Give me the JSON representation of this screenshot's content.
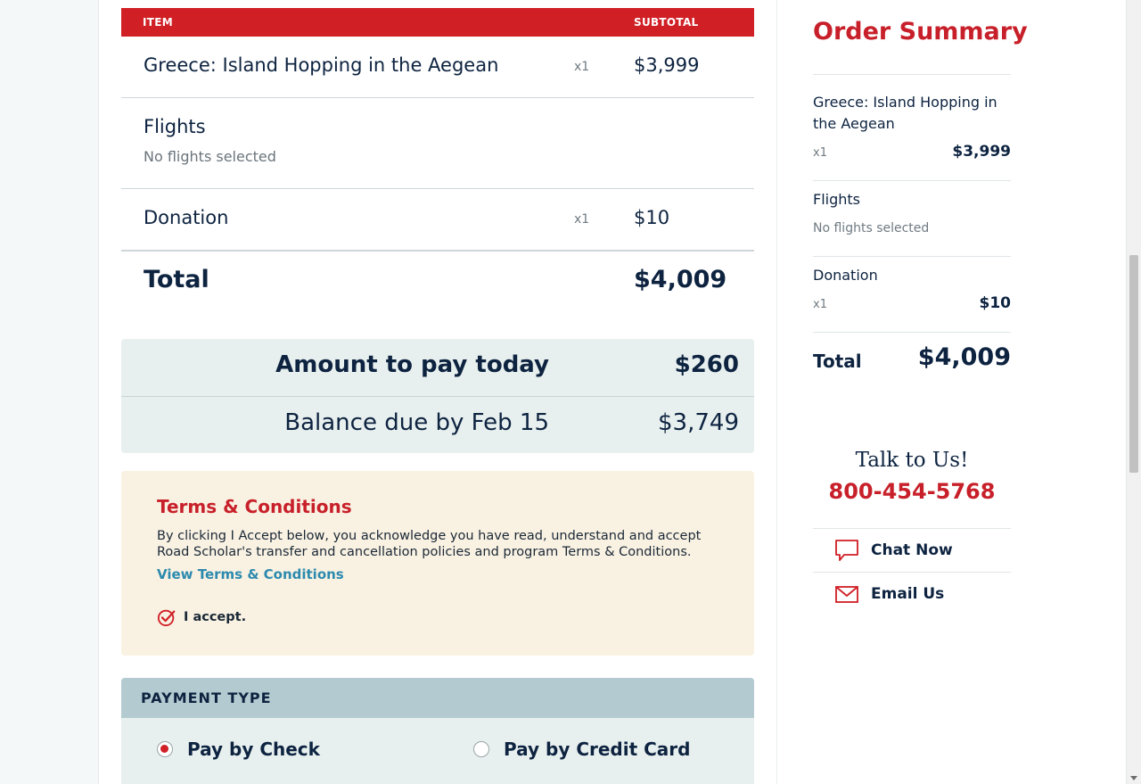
{
  "cart": {
    "header_item": "ITEM",
    "header_subtotal": "SUBTOTAL",
    "trip": {
      "name": "Greece: Island Hopping in the Aegean",
      "qty": "x1",
      "price": "$3,999"
    },
    "flights": {
      "name": "Flights",
      "note": "No flights selected"
    },
    "donation": {
      "name": "Donation",
      "qty": "x1",
      "price": "$10"
    },
    "total_label": "Total",
    "total_value": "$4,009"
  },
  "payment_summary": {
    "today_label": "Amount to pay today",
    "today_value": "$260",
    "balance_label": "Balance due by Feb 15",
    "balance_value": "$3,749"
  },
  "terms": {
    "title": "Terms & Conditions",
    "body": "By clicking I Accept below, you acknowledge you have read, understand and accept Road Scholar's transfer and cancellation policies and program Terms & Conditions.",
    "link": "View Terms & Conditions",
    "accept_label": "I accept."
  },
  "payment_type": {
    "heading": "PAYMENT TYPE",
    "option_check": "Pay by Check",
    "option_card": "Pay by Credit Card",
    "selected": "check"
  },
  "sidebar": {
    "heading": "Order Summary",
    "trip_name": "Greece: Island Hopping in the Aegean",
    "trip_qty": "x1",
    "trip_price": "$3,999",
    "flights_name": "Flights",
    "flights_note": "No flights selected",
    "donation_name": "Donation",
    "donation_qty": "x1",
    "donation_price": "$10",
    "total_label": "Total",
    "total_value": "$4,009",
    "talk": "Talk to Us!",
    "phone": "800-454-5768",
    "chat": "Chat Now",
    "email": "Email Us"
  },
  "colors": {
    "brand_red": "#d01f25",
    "navy": "#0d2340",
    "link_blue": "#2d8aae",
    "terms_bg": "#f9f2e3",
    "pay_bg": "#e8f0ef"
  },
  "icons": {
    "accept": "check-circle-icon",
    "chat": "chat-bubble-icon",
    "email": "envelope-icon"
  }
}
